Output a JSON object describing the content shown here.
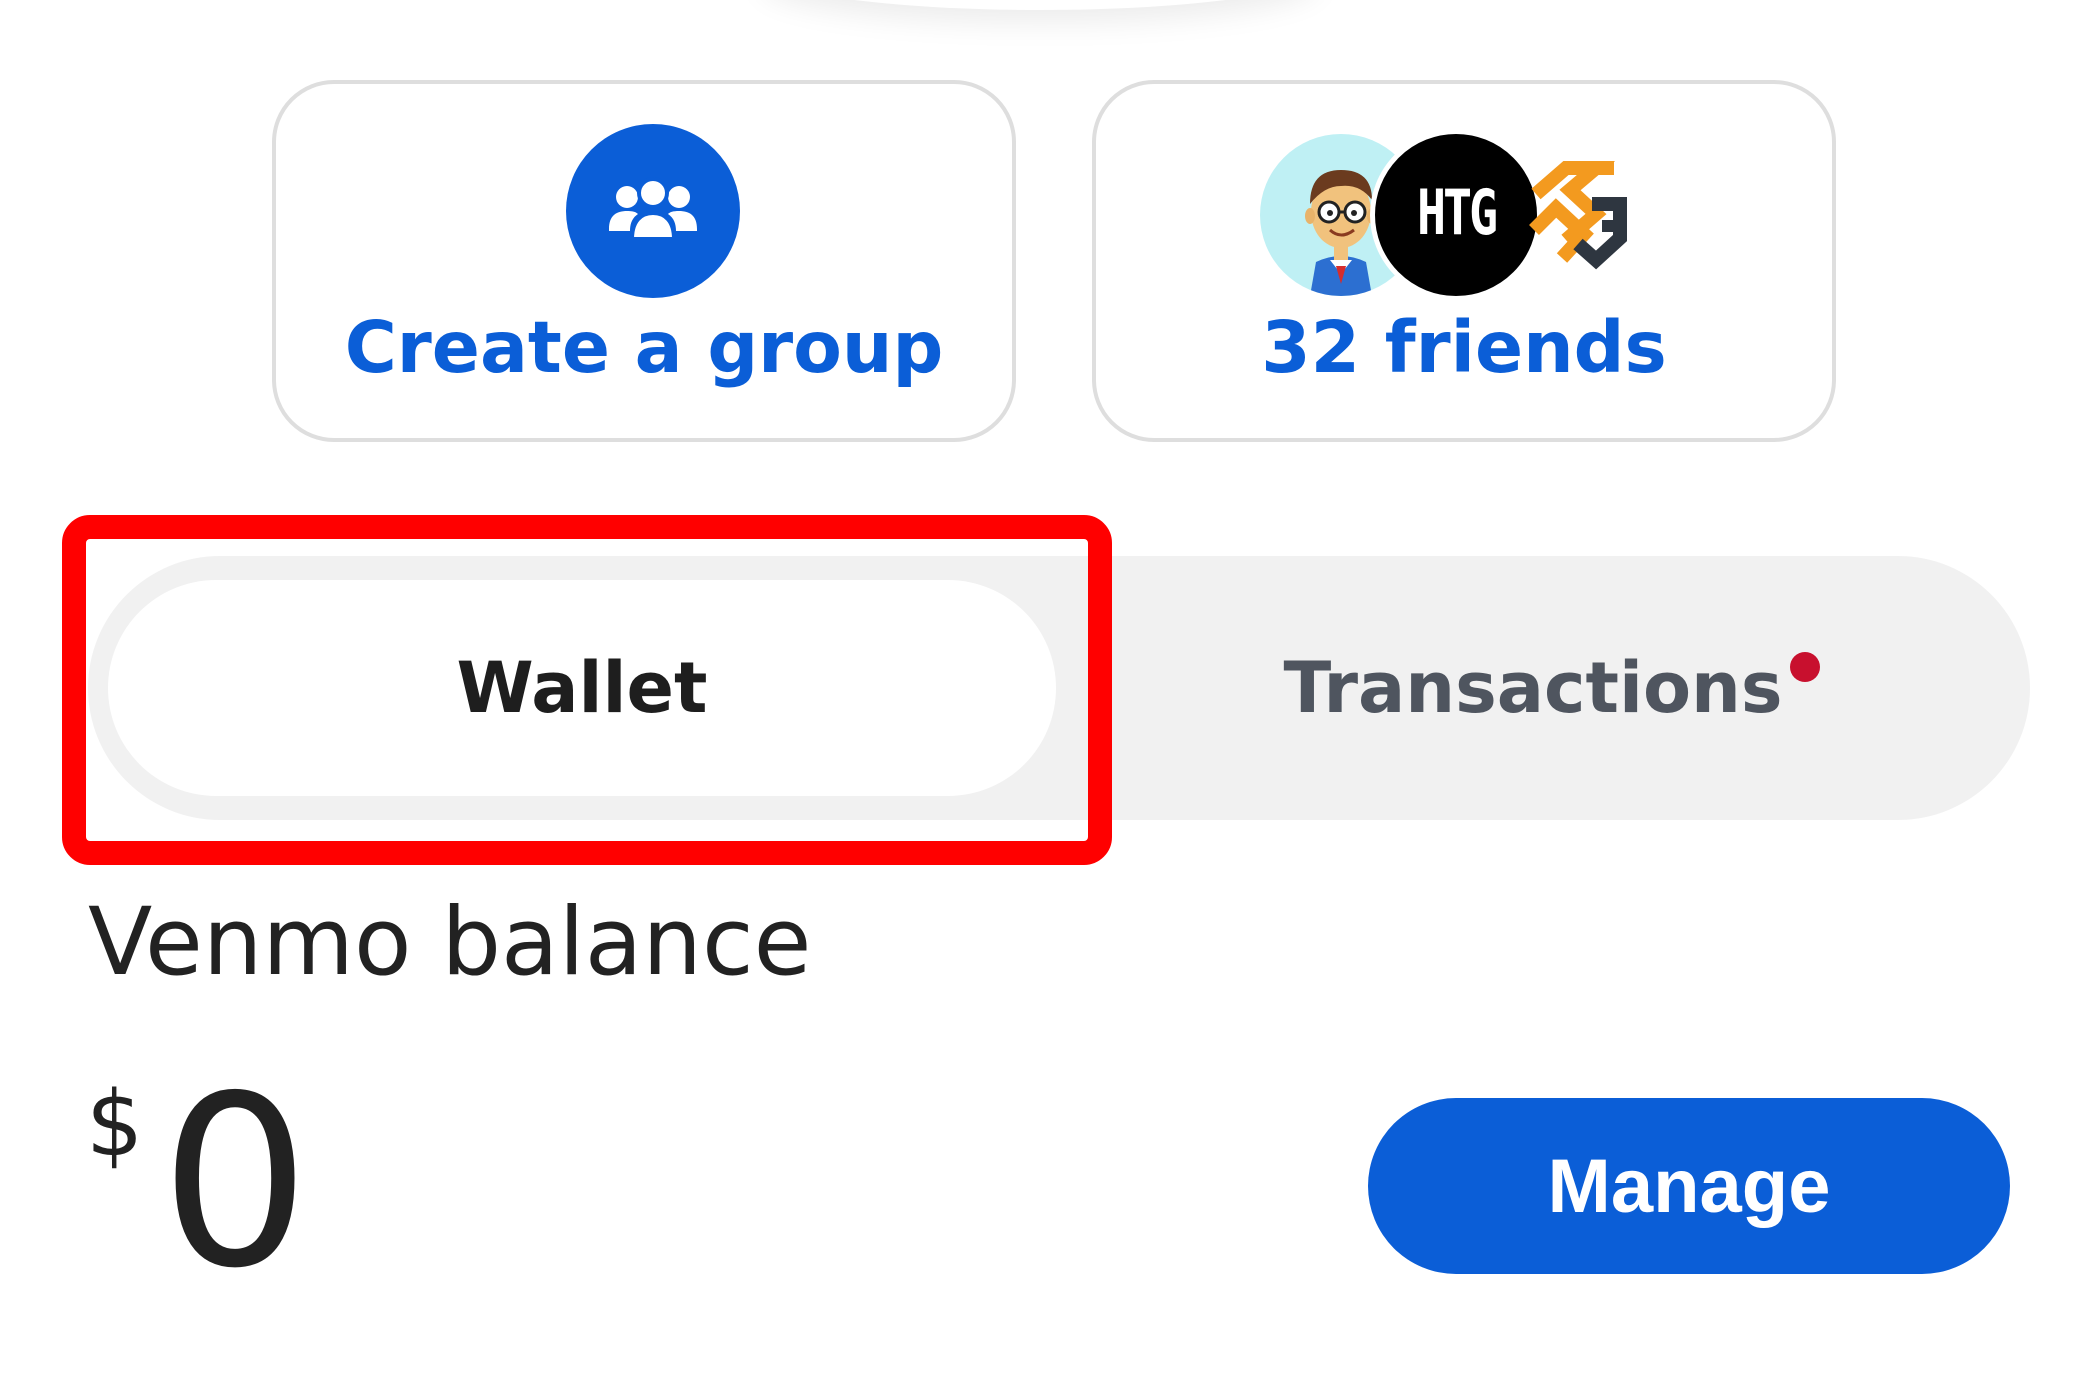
{
  "colors": {
    "accent": "#0b5ed7",
    "highlight": "#ff0000",
    "notification_dot": "#c8102e",
    "tab_track": "#f1f1f1"
  },
  "actions": {
    "create_group": {
      "label": "Create a group",
      "icon": "group-icon"
    },
    "friends": {
      "label": "32 friends",
      "avatars": [
        {
          "name": "cartoon-avatar",
          "icon": "cartoon-person-icon"
        },
        {
          "name": "htg-avatar",
          "text": "HTG"
        },
        {
          "name": "htg-logo-avatar",
          "icon": "htg-logo-icon"
        }
      ]
    }
  },
  "tabs": [
    {
      "label": "Wallet",
      "selected": true
    },
    {
      "label": "Transactions",
      "selected": false,
      "has_notification": true
    }
  ],
  "balance": {
    "label": "Venmo balance",
    "currency_symbol": "$",
    "amount": "0",
    "manage_label": "Manage"
  }
}
